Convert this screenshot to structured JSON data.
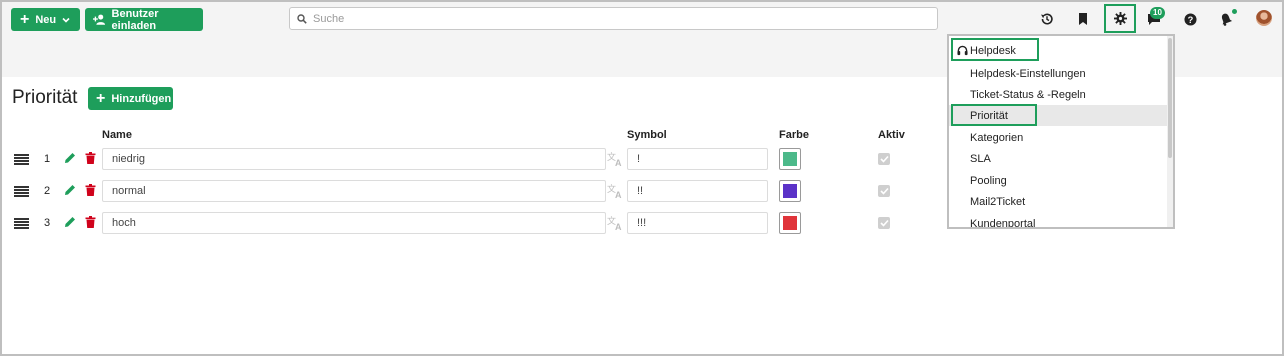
{
  "toolbar": {
    "new_label": "Neu",
    "invite_label": "Benutzer einladen",
    "search_placeholder": "Suche",
    "chat_badge": "10",
    "accent_color": "#1e9e5b"
  },
  "page": {
    "title": "Priorität",
    "add_label": "Hinzufügen"
  },
  "columns": {
    "name": "Name",
    "symbol": "Symbol",
    "color": "Farbe",
    "active": "Aktiv"
  },
  "rows": [
    {
      "index": "1",
      "name": "niedrig",
      "symbol": "!",
      "color": "#4cb98a",
      "active": true
    },
    {
      "index": "2",
      "name": "normal",
      "symbol": "!!",
      "color": "#5b32c8",
      "active": true
    },
    {
      "index": "3",
      "name": "hoch",
      "symbol": "!!!",
      "color": "#e0343a",
      "active": true
    }
  ],
  "settings_menu": {
    "items": [
      {
        "label": "Helpdesk",
        "icon": "headset-icon"
      },
      {
        "label": "Helpdesk-Einstellungen"
      },
      {
        "label": "Ticket-Status & -Regeln"
      },
      {
        "label": "Priorität",
        "active": true
      },
      {
        "label": "Kategorien"
      },
      {
        "label": "SLA"
      },
      {
        "label": "Pooling"
      },
      {
        "label": "Mail2Ticket"
      },
      {
        "label": "Kundenportal"
      }
    ]
  }
}
